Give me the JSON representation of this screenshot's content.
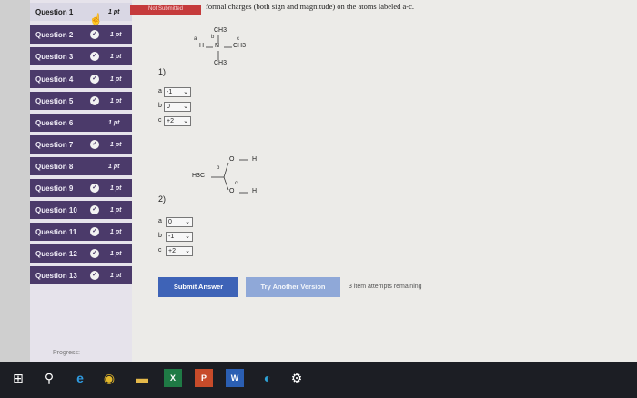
{
  "sidebar": {
    "items": [
      {
        "label": "Question 1",
        "points": "1 pt",
        "checked": false,
        "active": true
      },
      {
        "label": "Question 2",
        "points": "1 pt",
        "checked": true
      },
      {
        "label": "Question 3",
        "points": "1 pt",
        "checked": true
      },
      {
        "label": "Question 4",
        "points": "1 pt",
        "checked": true
      },
      {
        "label": "Question 5",
        "points": "1 pt",
        "checked": true
      },
      {
        "label": "Question 6",
        "points": "1 pt",
        "checked": false
      },
      {
        "label": "Question 7",
        "points": "1 pt",
        "checked": true
      },
      {
        "label": "Question 8",
        "points": "1 pt",
        "checked": false
      },
      {
        "label": "Question 9",
        "points": "1 pt",
        "checked": true
      },
      {
        "label": "Question 10",
        "points": "1 pt",
        "checked": true
      },
      {
        "label": "Question 11",
        "points": "1 pt",
        "checked": true
      },
      {
        "label": "Question 12",
        "points": "1 pt",
        "checked": true
      },
      {
        "label": "Question 13",
        "points": "1 pt",
        "checked": true
      }
    ],
    "progress_label": "Progress:"
  },
  "question": {
    "status_badge": "Not Submitted",
    "prompt": "formal charges (both sign and magnitude) on the atoms labeled a-c.",
    "part1": {
      "number": "1)",
      "molecule": {
        "top": "CH3",
        "left": "H",
        "center": "N",
        "right": "CH3",
        "bottom": "CH3",
        "label_a": "a",
        "label_b": "b",
        "label_c": "c"
      },
      "answers": [
        {
          "label": "a",
          "value": "-1"
        },
        {
          "label": "b",
          "value": "0"
        },
        {
          "label": "c",
          "value": "+2"
        }
      ]
    },
    "part2": {
      "number": "2)",
      "molecule": {
        "left": "H3C",
        "label_b": "b",
        "label_c": "c",
        "top_atom": "O",
        "top_h": "H",
        "bottom_atom": "O",
        "bottom_h": "H"
      },
      "answers": [
        {
          "label": "a",
          "value": "0"
        },
        {
          "label": "b",
          "value": "-1"
        },
        {
          "label": "c",
          "value": "+2"
        }
      ]
    },
    "submit_label": "Submit Answer",
    "try_label": "Try Another Version",
    "attempts": "3 item attempts remaining"
  },
  "colors": {
    "sidebar": "#4b3a6a",
    "submit": "#3e63b7",
    "try": "#8fa8d8",
    "badge": "#c53b3b"
  },
  "taskbar": {
    "icons": [
      "windows-icon",
      "search-icon",
      "edge-icon",
      "chrome-icon",
      "file-explorer-icon",
      "excel-icon",
      "powerpoint-icon",
      "word-icon",
      "edge-new-icon",
      "settings-icon"
    ]
  }
}
